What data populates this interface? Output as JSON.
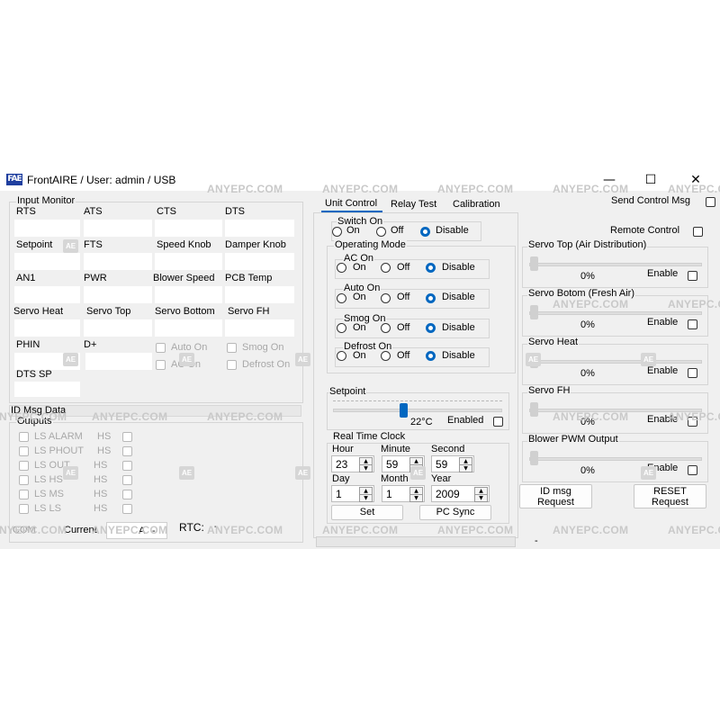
{
  "window": {
    "title": "FrontAIRE  / User: admin / USB",
    "icon_name": "frontaire-logo-icon",
    "icon_text": "FAE",
    "minimize": "—",
    "maximize": "☐",
    "close": "✕"
  },
  "input_monitor": {
    "title": "Input Monitor",
    "rows": [
      [
        "RTS",
        "ATS",
        "CTS",
        "DTS"
      ],
      [
        "Setpoint",
        "FTS",
        "Speed Knob",
        "Damper Knob"
      ],
      [
        "AN1",
        "PWR",
        "Blower Speed",
        "PCB Temp"
      ],
      [
        "Servo Heat",
        "Servo Top",
        "Servo Bottom",
        "Servo FH"
      ]
    ],
    "phin": "PHIN",
    "dplus": "D+",
    "dts_sp": "DTS SP",
    "auto_on": "Auto On",
    "smog_on": "Smog On",
    "ac_on": "AC On",
    "defrost_on": "Defrost On"
  },
  "id_msg_data": "ID Msg Data",
  "outputs": {
    "title": "Outputs",
    "left": [
      "LS  ALARM",
      "LS  PHOUT",
      "LS  OUT",
      "LS  HS",
      "LS  MS",
      "LS  LS"
    ],
    "right": [
      "HS",
      "HS",
      "HS",
      "HS",
      "HS",
      "HS"
    ]
  },
  "status": {
    "com": "COM",
    "current_label": "Current",
    "current_value": "A",
    "current_dash": "-",
    "rtc_label": "RTC:",
    "rtc_value": "-",
    "bottom_dash": "-"
  },
  "tabs": [
    "Unit Control",
    "Relay Test",
    "Calibration"
  ],
  "switch_on": {
    "title": "Switch On",
    "on": "On",
    "off": "Off",
    "disable": "Disable"
  },
  "operating_mode": {
    "title": "Operating Mode",
    "groups": [
      {
        "title": "AC On",
        "on": "On",
        "off": "Off",
        "disable": "Disable"
      },
      {
        "title": "Auto On",
        "on": "On",
        "off": "Off",
        "disable": "Disable"
      },
      {
        "title": "Smog On",
        "on": "On",
        "off": "Off",
        "disable": "Disable"
      },
      {
        "title": "Defrost On",
        "on": "On",
        "off": "Off",
        "disable": "Disable"
      }
    ]
  },
  "setpoint": {
    "title": "Setpoint",
    "value": "22°C",
    "enabled": "Enabled"
  },
  "clock": {
    "title": "Real Time Clock",
    "hour_label": "Hour",
    "minute_label": "Minute",
    "second_label": "Second",
    "day_label": "Day",
    "month_label": "Month",
    "year_label": "Year",
    "hour": "23",
    "minute": "59",
    "second": "59",
    "day": "1",
    "month": "1",
    "year": "2009",
    "set": "Set",
    "pc_sync": "PC Sync"
  },
  "send_control_msg": "Send Control Msg",
  "remote_control": "Remote Control",
  "servos": [
    {
      "title": "Servo Top (Air Distribution)",
      "percent": "0%",
      "enable": "Enable"
    },
    {
      "title": "Servo Botom (Fresh Air)",
      "percent": "0%",
      "enable": "Enable"
    },
    {
      "title": "Servo Heat",
      "percent": "0%",
      "enable": "Enable"
    },
    {
      "title": "Servo FH",
      "percent": "0%",
      "enable": "Enable"
    },
    {
      "title": "Blower PWM Output",
      "percent": "0%",
      "enable": "Enable"
    }
  ],
  "id_msg_request": "ID msg\nRequest",
  "reset_request": "RESET\nRequest",
  "watermark": {
    "text": "ANYEPC.COM",
    "logo": "AE"
  },
  "colors": {
    "accent": "#0067c0",
    "window_bg": "#f0f0f0"
  }
}
